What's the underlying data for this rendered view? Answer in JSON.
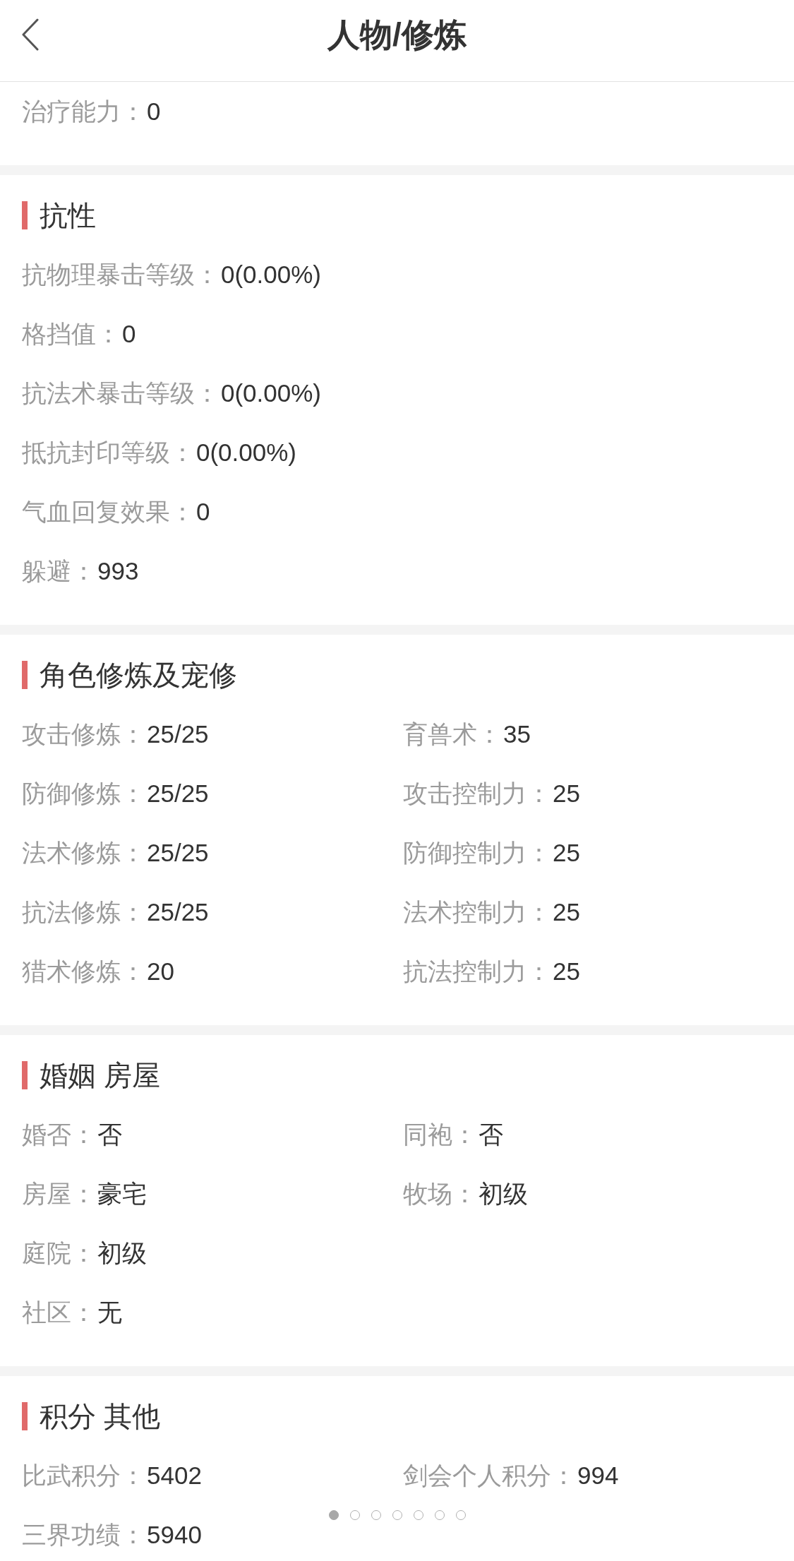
{
  "header": {
    "title": "人物/修炼"
  },
  "sections": [
    {
      "rows": [
        [
          {
            "label": "治疗能力：",
            "value": "0"
          }
        ]
      ]
    },
    {
      "title": "抗性",
      "rows": [
        [
          {
            "label": "抗物理暴击等级：",
            "value": "0(0.00%)"
          }
        ],
        [
          {
            "label": "格挡值：",
            "value": "0"
          }
        ],
        [
          {
            "label": "抗法术暴击等级：",
            "value": "0(0.00%)"
          }
        ],
        [
          {
            "label": "抵抗封印等级：",
            "value": "0(0.00%)"
          }
        ],
        [
          {
            "label": "气血回复效果：",
            "value": "0"
          }
        ],
        [
          {
            "label": "躲避：",
            "value": "993"
          }
        ]
      ]
    },
    {
      "title": "角色修炼及宠修",
      "rows": [
        [
          {
            "label": "攻击修炼：",
            "value": "25/25"
          },
          {
            "label": "育兽术：",
            "value": "35"
          }
        ],
        [
          {
            "label": "防御修炼：",
            "value": "25/25"
          },
          {
            "label": "攻击控制力：",
            "value": "25"
          }
        ],
        [
          {
            "label": "法术修炼：",
            "value": "25/25"
          },
          {
            "label": "防御控制力：",
            "value": "25"
          }
        ],
        [
          {
            "label": "抗法修炼：",
            "value": "25/25"
          },
          {
            "label": "法术控制力：",
            "value": "25"
          }
        ],
        [
          {
            "label": "猎术修炼：",
            "value": "20"
          },
          {
            "label": "抗法控制力：",
            "value": "25"
          }
        ]
      ]
    },
    {
      "title": "婚姻 房屋",
      "rows": [
        [
          {
            "label": "婚否：",
            "value": "否"
          },
          {
            "label": "同袍：",
            "value": "否"
          }
        ],
        [
          {
            "label": "房屋：",
            "value": "豪宅"
          },
          {
            "label": "牧场：",
            "value": "初级"
          }
        ],
        [
          {
            "label": "庭院：",
            "value": "初级"
          }
        ],
        [
          {
            "label": "社区：",
            "value": "无"
          }
        ]
      ]
    },
    {
      "title": "积分 其他",
      "rows": [
        [
          {
            "label": "比武积分：",
            "value": "5402"
          },
          {
            "label": "剑会个人积分：",
            "value": "994"
          }
        ],
        [
          {
            "label": "三界功绩：",
            "value": "5940"
          }
        ]
      ]
    }
  ],
  "pager": {
    "dots": [
      {
        "selected": true
      },
      {
        "selected": false
      },
      {
        "selected": false
      },
      {
        "selected": false
      },
      {
        "selected": false
      },
      {
        "selected": false
      },
      {
        "selected": false
      }
    ]
  }
}
